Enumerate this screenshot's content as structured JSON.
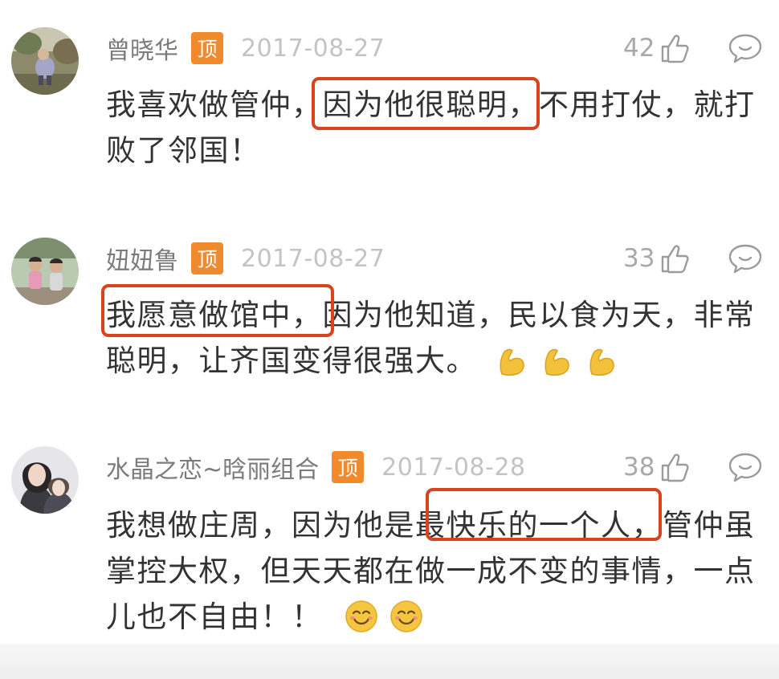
{
  "top_badge": "顶",
  "comments": [
    {
      "username": "曾晓华",
      "date": "2017-08-27",
      "likes": "42",
      "text": "我喜欢做管仲，因为他很聪明，不用打仗，就打败了邻国！",
      "avatar_icon": "avatar-child-outdoors"
    },
    {
      "username": "妞妞鲁",
      "date": "2017-08-27",
      "likes": "33",
      "text": "我愿意做馆中，因为他知道，民以食为天，非常聪明，让齐国变得很强大。",
      "emojis": [
        "flexed-biceps-icon",
        "flexed-biceps-icon",
        "flexed-biceps-icon"
      ],
      "avatar_icon": "avatar-two-children"
    },
    {
      "username": "水晶之恋~晗丽组合",
      "date": "2017-08-28",
      "likes": "38",
      "text": "我想做庄周，因为他是最快乐的一个人，管仲虽掌控大权，但天天都在做一成不变的事情，一点儿也不自由！！",
      "emojis": [
        "smiling-face-icon",
        "smiling-face-icon"
      ],
      "avatar_icon": "avatar-two-people"
    }
  ],
  "colors": {
    "username": "#7b7b7b",
    "date": "#c3c3c3",
    "badge": "#f08a2c",
    "highlight_box": "#d9441f",
    "body_text": "#333333"
  }
}
